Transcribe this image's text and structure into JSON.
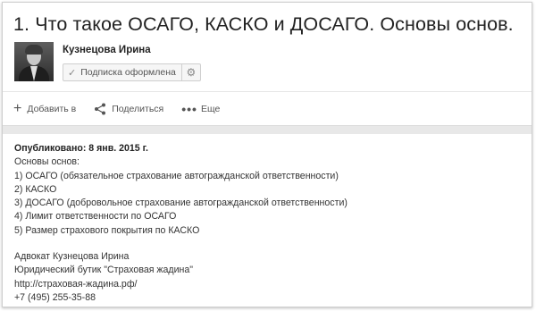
{
  "video": {
    "title": "1. Что такое ОСАГО, КАСКО и ДОСАГО. Основы основ."
  },
  "channel": {
    "author_name": "Кузнецова Ирина",
    "subscribe_label": "Подписка оформлена",
    "subscribe_check_icon": "check-icon",
    "settings_icon": "gear-icon"
  },
  "actions": {
    "add_to_label": "Добавить в",
    "share_label": "Поделиться",
    "more_label": "Еще"
  },
  "description": {
    "published": "Опубликовано: 8 янв. 2015 г.",
    "lines": [
      "Основы основ:",
      "1) ОСАГО (обязательное страхование автогражданской ответственности)",
      "2) КАСКО",
      "3) ДОСАГО (добровольное страхование автогражданской ответственности)",
      "4) Лимит ответственности по ОСАГО",
      "5) Размер страхового покрытия по КАСКО"
    ],
    "contact_lines": [
      "Адвокат Кузнецова Ирина",
      "Юридический бутик \"Страховая жадина\"",
      "http://страховая-жадина.рф/",
      "+7 (495) 255-35-88"
    ]
  }
}
